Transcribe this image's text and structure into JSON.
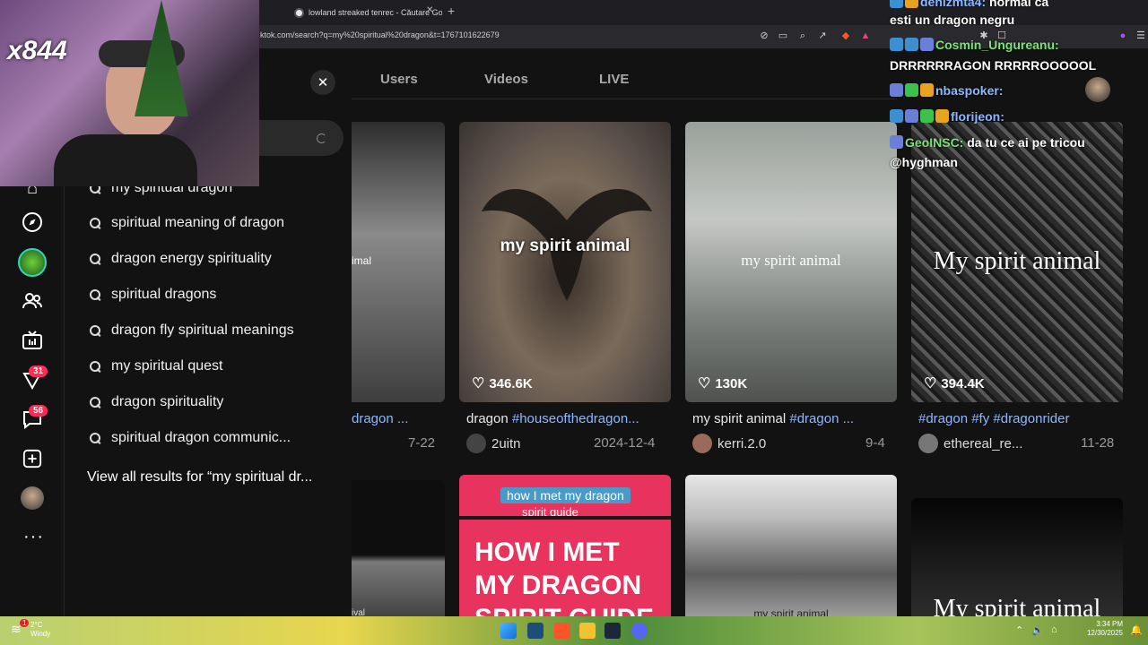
{
  "browser": {
    "tab_title": "lowland streaked tenrec - Căutare Google",
    "tab_close": "✕",
    "new_tab": "+",
    "url": "ktok.com/search?q=my%20spiritual%20dragon&t=1767101622679"
  },
  "webcam": {
    "overlay_text": "x844"
  },
  "left_rail": {
    "badges": {
      "activity": "31",
      "messages": "56"
    },
    "more": "···"
  },
  "search": {
    "close": "✕",
    "suggestions": [
      "my spiritual dragon",
      "spiritual meaning of dragon",
      "dragon energy spirituality",
      "spiritual dragons",
      "dragon fly spiritual meanings",
      "my spiritual quest",
      "dragon spirituality",
      "spiritual dragon communic..."
    ],
    "view_all": "View all results for “my spiritual dr..."
  },
  "results": {
    "tabs": [
      "Users",
      "Videos",
      "LIVE"
    ],
    "cards": [
      {
        "overlay": "imal",
        "desc_plain": "",
        "desc_tag": "dragon ...",
        "user": "",
        "date": "7-22"
      },
      {
        "overlay": "my spirit animal",
        "likes": "346.6K",
        "desc_plain": "dragon ",
        "desc_tag": "#houseofthedragon...",
        "user": "2uitn",
        "date": "2024-12-4"
      },
      {
        "overlay": "my spirit animal",
        "likes": "130K",
        "desc_plain": "my spirit animal ",
        "desc_tag": "#dragon ...",
        "user": "kerri.2.0",
        "date": "9-4"
      },
      {
        "overlay": "My spirit animal",
        "likes": "394.4K",
        "desc_plain": "",
        "desc_tag": "#dragon #fy #dragonrider",
        "user": "ethereal_re...",
        "date": "11-28"
      }
    ],
    "row2": {
      "caption_line1": "how I met my dragon",
      "caption_line2": "spirit guide",
      "headline": [
        "HOW I MET",
        "MY DRAGON",
        "SPIRIT GUIDE"
      ],
      "overlay3": "my spirit animal",
      "overlay4": "My spirit animal",
      "overlay1": "ival"
    }
  },
  "chat": [
    {
      "user": "denizmta4:",
      "msg": "normal ca",
      "color": "#ffffff"
    },
    {
      "user": "",
      "msg": "esti un dragon negru",
      "color": "#ffffff"
    },
    {
      "user": "Cosmin_Ungureanu:",
      "msg": "",
      "color": "#7ee07e"
    },
    {
      "user": "",
      "msg": "DRRRRRRAGON RRRRROOOOOL",
      "color": "#ffffff"
    },
    {
      "user": "nbaspoker:",
      "msg": "",
      "color": "#8fb7ff"
    },
    {
      "user": "florijeon:",
      "msg": "",
      "color": "#8fb7ff"
    },
    {
      "user": "GeoINSC:",
      "msg": "da tu ce ai pe tricou",
      "color": "#7ee07e"
    },
    {
      "user": "",
      "msg": "@hyghman",
      "color": "#ffffff"
    }
  ],
  "taskbar": {
    "weather_temp": "2°C",
    "weather_desc": "Windy",
    "weather_alert": "1",
    "time": "3:34 PM",
    "date": "12/30/2025"
  }
}
